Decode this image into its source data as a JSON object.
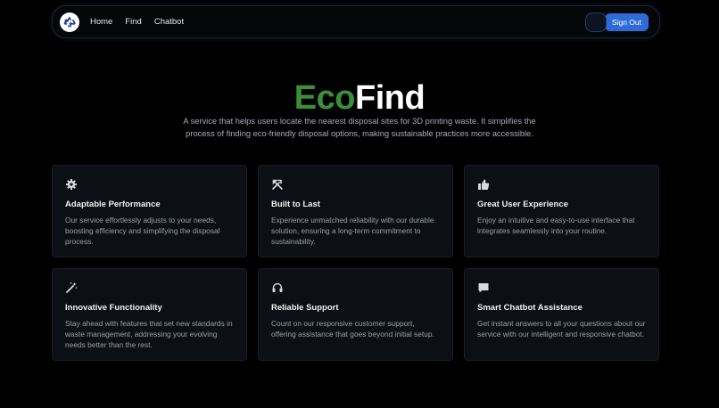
{
  "nav": {
    "links": [
      "Home",
      "Find",
      "Chatbot"
    ],
    "sign_out_label": "Sign Out",
    "logo_icon": "recycle-icon",
    "theme_icon": "moon-icon"
  },
  "hero": {
    "title_part1": "Eco",
    "title_part2": "Find",
    "description": "A service that helps users locate the nearest disposal sites for 3D printing waste. It simplifies the process of finding eco-friendly disposal options, making sustainable practices more accessible."
  },
  "features": [
    {
      "icon": "gear-icon",
      "title": "Adaptable Performance",
      "text": "Our service effortlessly adjusts to your needs, boosting efficiency and simplifying the disposal process."
    },
    {
      "icon": "tools-icon",
      "title": "Built to Last",
      "text": "Experience unmatched reliability with our durable solution, ensuring a long-term commitment to sustainability."
    },
    {
      "icon": "thumbs-up-icon",
      "title": "Great User Experience",
      "text": "Enjoy an intuitive and easy-to-use interface that integrates seamlessly into your routine."
    },
    {
      "icon": "magic-wand-icon",
      "title": "Innovative Functionality",
      "text": "Stay ahead with features that set new standards in waste management, addressing your evolving needs better than the rest."
    },
    {
      "icon": "headset-icon",
      "title": "Reliable Support",
      "text": "Count on our responsive customer support, offering assistance that goes beyond initial setup."
    },
    {
      "icon": "chat-icon",
      "title": "Smart Chatbot Assistance",
      "text": "Get instant answers to all your questions about our service with our intelligent and responsive chatbot."
    }
  ],
  "colors": {
    "background": "#000000",
    "accent_green": "#3c8f3a",
    "button_blue": "#2f6bd6",
    "card_bg": "#0c0f14"
  }
}
